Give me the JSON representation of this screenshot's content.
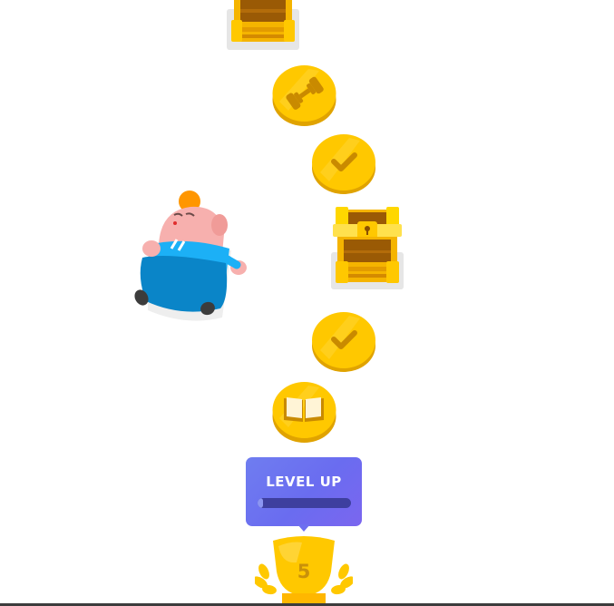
{
  "path": {
    "nodes": [
      {
        "kind": "chest",
        "state": "locked-top",
        "icon": "chest-icon"
      },
      {
        "kind": "lesson",
        "state": "completed",
        "icon": "dumbbell-icon"
      },
      {
        "kind": "lesson",
        "state": "completed",
        "icon": "check-icon"
      },
      {
        "kind": "chest",
        "state": "locked",
        "icon": "chest-icon"
      },
      {
        "kind": "lesson",
        "state": "completed",
        "icon": "check-icon"
      },
      {
        "kind": "lesson",
        "state": "completed",
        "icon": "book-icon"
      }
    ],
    "level_up": {
      "label": "LEVEL UP",
      "progress_fraction": 0.04
    },
    "trophy": {
      "number": "5",
      "icon": "trophy-icon"
    },
    "mascot": {
      "icon": "mascot-character-icon"
    }
  },
  "colors": {
    "coin_gold": "#ffc800",
    "coin_dark": "#e0a300",
    "level_up_bg": "#6f73f0",
    "level_up_track": "#3e3f9f",
    "mascot_blue": "#0085c8"
  }
}
